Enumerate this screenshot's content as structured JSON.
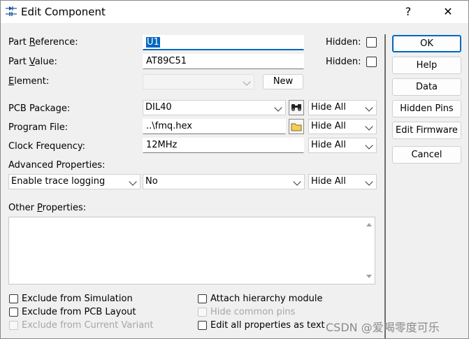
{
  "window": {
    "title": "Edit Component",
    "help_glyph": "?",
    "close_glyph": "✕"
  },
  "labels": {
    "part_reference": "Part Reference:",
    "part_value": "Part Value:",
    "element": "Element:",
    "pcb_package": "PCB Package:",
    "program_file": "Program File:",
    "clock_frequency": "Clock Frequency:",
    "advanced_properties": "Advanced Properties:",
    "other_properties": "Other Properties:",
    "hidden": "Hidden:"
  },
  "fields": {
    "part_reference": "U1",
    "part_value": "AT89C51",
    "element": "",
    "pcb_package": "DIL40",
    "program_file": "..\\fmq.hex",
    "clock_frequency": "12MHz",
    "advanced_property": "Enable trace logging",
    "advanced_value": "No",
    "other_properties": ""
  },
  "visibility": {
    "pcb_package": "Hide All",
    "program_file": "Hide All",
    "clock_frequency": "Hide All",
    "advanced": "Hide All"
  },
  "buttons": {
    "new": "New",
    "ok": "OK",
    "help": "Help",
    "data": "Data",
    "hidden_pins": "Hidden Pins",
    "edit_firmware": "Edit Firmware",
    "cancel": "Cancel"
  },
  "checkboxes": {
    "exclude_simulation": "Exclude from Simulation",
    "exclude_pcb": "Exclude from PCB Layout",
    "exclude_variant": "Exclude from Current Variant",
    "attach_hierarchy": "Attach hierarchy module",
    "hide_common_pins": "Hide common pins",
    "edit_all_text": "Edit all properties as text"
  },
  "watermark": "CSDN @爱喝零度可乐",
  "icons": {
    "app": "component-icon",
    "browse_package": "binoculars-icon",
    "browse_file": "folder-icon"
  },
  "colors": {
    "accent": "#0067c0",
    "background": "#f0f0f0"
  }
}
